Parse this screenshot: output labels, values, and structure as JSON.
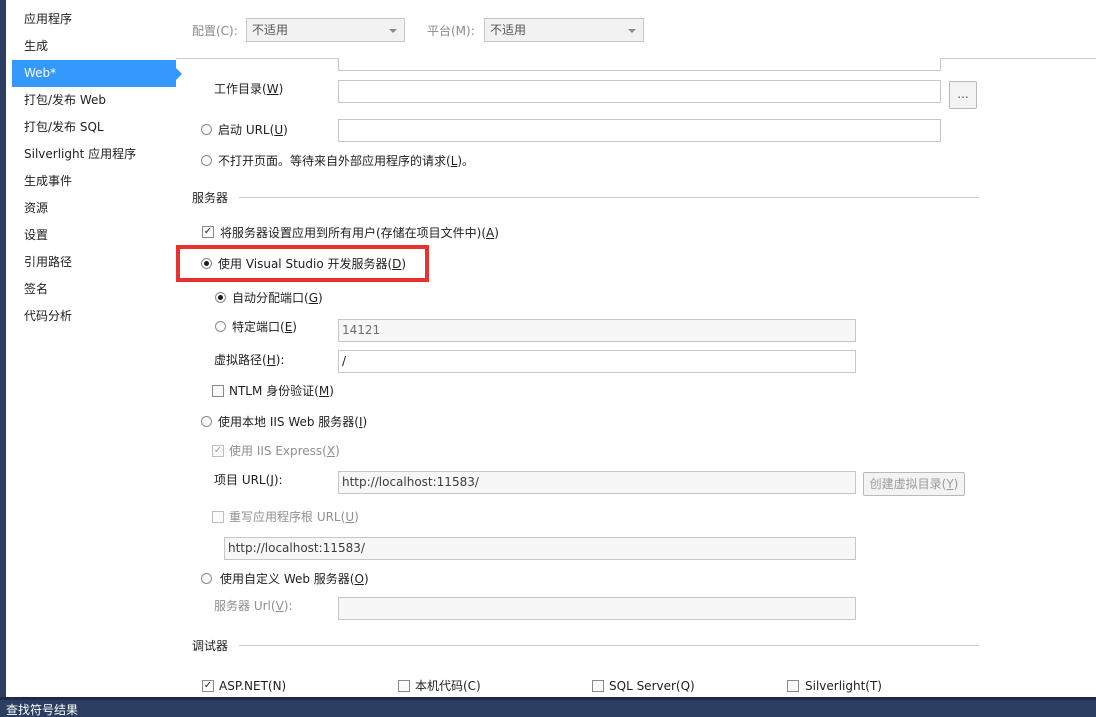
{
  "sidebar": {
    "items": [
      {
        "label": "应用程序"
      },
      {
        "label": "生成"
      },
      {
        "label": "Web*"
      },
      {
        "label": "打包/发布 Web"
      },
      {
        "label": "打包/发布 SQL"
      },
      {
        "label": "Silverlight 应用程序"
      },
      {
        "label": "生成事件"
      },
      {
        "label": "资源"
      },
      {
        "label": "设置"
      },
      {
        "label": "引用路径"
      },
      {
        "label": "签名"
      },
      {
        "label": "代码分析"
      }
    ],
    "active_index": 2
  },
  "header": {
    "config_label": "配置(C):",
    "config_value": "不适用",
    "platform_label": "平台(M):",
    "platform_value": "不适用"
  },
  "start": {
    "workdir_label": "工作目录(",
    "workdir_key": "W",
    "workdir_close": ")",
    "browse_label": "...",
    "start_url_label": "启动 URL(",
    "start_url_key": "U",
    "start_url_close": ")",
    "no_open_label": "不打开页面。等待来自外部应用程序的请求(",
    "no_open_key": "L",
    "no_open_close": ")。"
  },
  "server": {
    "section_title": "服务器",
    "apply_all_label": "将服务器设置应用到所有用户(存储在项目文件中)(",
    "apply_all_key": "A",
    "apply_all_close": ")",
    "apply_all_checked": true,
    "vs_dev_label": "使用 Visual Studio 开发服务器(",
    "vs_dev_key": "D",
    "vs_dev_close": ")",
    "vs_dev_selected": true,
    "auto_port_label": "自动分配端口(",
    "auto_port_key": "G",
    "auto_port_close": ")",
    "auto_port_selected": true,
    "specific_port_label": "特定端口(",
    "specific_port_key": "E",
    "specific_port_close": ")",
    "specific_port_value": "14121",
    "virtual_path_label": "虚拟路径(",
    "virtual_path_key": "H",
    "virtual_path_close": "):",
    "virtual_path_value": "/",
    "ntlm_label": "NTLM 身份验证(",
    "ntlm_key": "M",
    "ntlm_close": ")",
    "ntlm_checked": false,
    "local_iis_label": "使用本地 IIS Web 服务器(",
    "local_iis_key": "I",
    "local_iis_close": ")",
    "iis_express_label": "使用 IIS Express(",
    "iis_express_key": "X",
    "iis_express_close": ")",
    "iis_express_checked": true,
    "project_url_label": "项目 URL(",
    "project_url_key": "J",
    "project_url_close": "):",
    "project_url_value": "http://localhost:11583/",
    "create_vdir_label": "创建虚拟目录(",
    "create_vdir_key": "Y",
    "create_vdir_close": ")",
    "override_root_label": "重写应用程序根 URL(",
    "override_root_key": "U",
    "override_root_close": ")",
    "override_root_checked": false,
    "override_root_value": "http://localhost:11583/",
    "custom_label": "使用自定义 Web 服务器(",
    "custom_key": "O",
    "custom_close": ")",
    "server_url_label": "服务器 Url(",
    "server_url_key": "V",
    "server_url_close": "):"
  },
  "debugger": {
    "section_title": "调试器",
    "items": [
      {
        "label": "ASP.NET(N)",
        "checked": true
      },
      {
        "label": "本机代码(C)",
        "checked": false
      },
      {
        "label": "SQL Server(Q)",
        "checked": false
      },
      {
        "label": "Silverlight(T)",
        "checked": false
      }
    ]
  },
  "bottom_panel": {
    "title": "查找符号结果"
  },
  "colors": {
    "active_item": "#3399ff",
    "highlight_box": "#e8322e",
    "frame": "#2b3e62"
  }
}
